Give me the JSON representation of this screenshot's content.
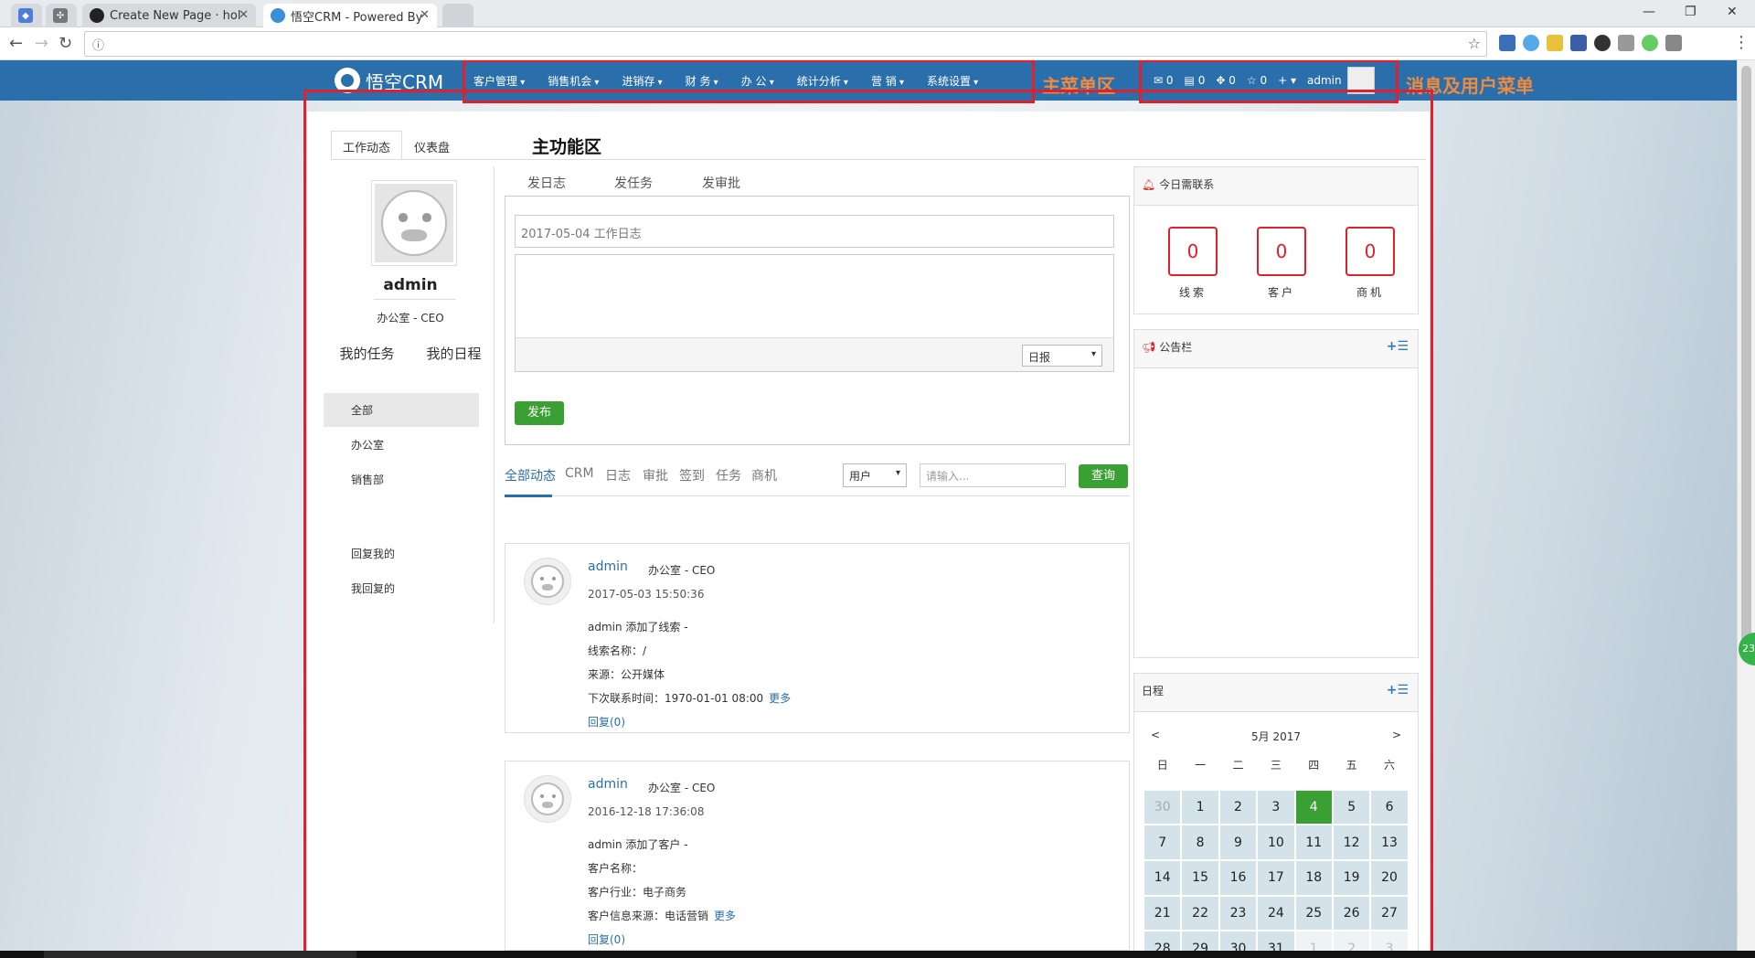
{
  "browser": {
    "tabs": [
      {
        "title": ""
      },
      {
        "title": ""
      },
      {
        "title": "Create New Page · hol"
      },
      {
        "title": "悟空CRM - Powered By"
      }
    ],
    "url": ""
  },
  "navbar": {
    "logo_text": "悟空CRM",
    "menu": [
      "客户管理",
      "销售机会",
      "进销存",
      "财 务",
      "办 公",
      "统计分析",
      "营 销",
      "系统设置"
    ],
    "menu_annotation": "主菜单区",
    "user": {
      "mail_count": "0",
      "msg_count": "0",
      "task_count": "0",
      "star_count": "0",
      "plus": "+",
      "username": "admin"
    },
    "user_annotation": "消息及用户菜单"
  },
  "main": {
    "area_annotation": "主功能区",
    "tabs": [
      "工作动态",
      "仪表盘"
    ],
    "profile": {
      "name": "admin",
      "role": "办公室 - CEO",
      "links": [
        "我的任务",
        "我的日程"
      ]
    },
    "side_groups": [
      "全部",
      "办公室",
      "销售部"
    ],
    "side_replies": [
      "回复我的",
      "我回复的"
    ],
    "post": {
      "tabs": [
        "发日志",
        "发任务",
        "发审批"
      ],
      "title_placeholder": "2017-05-04 工作日志",
      "type_select": "日报",
      "submit": "发布"
    },
    "filter": {
      "links": [
        "全部动态",
        "CRM",
        "日志",
        "审批",
        "签到",
        "任务",
        "商机"
      ],
      "user_select": "用户",
      "search_placeholder": "请输入...",
      "search_button": "查询"
    },
    "feed": [
      {
        "name": "admin",
        "role": "办公室 - CEO",
        "time": "2017-05-03 15:50:36",
        "lines": [
          "admin 添加了线索 -",
          "线索名称：/",
          "来源：公开媒体",
          "下次联系时间：1970-01-01 08:00"
        ],
        "more": "更多",
        "reply": "回复(0)"
      },
      {
        "name": "admin",
        "role": "办公室 - CEO",
        "time": "2016-12-18 17:36:08",
        "lines": [
          "admin 添加了客户 -",
          "客户名称：",
          "客户行业：电子商务",
          "客户信息来源：电话营销"
        ],
        "more": "更多",
        "reply": "回复(0)"
      }
    ],
    "contact_today": {
      "title": "今日需联系",
      "items": [
        {
          "count": "0",
          "label": "线索"
        },
        {
          "count": "0",
          "label": "客户"
        },
        {
          "count": "0",
          "label": "商机"
        }
      ]
    },
    "notice": {
      "title": "公告栏"
    },
    "schedule": {
      "title": "日程",
      "prev": "<",
      "next": ">",
      "month": "5月 2017",
      "weekdays": [
        "日",
        "一",
        "二",
        "三",
        "四",
        "五",
        "六"
      ],
      "days": [
        "30",
        "1",
        "2",
        "3",
        "4",
        "5",
        "6",
        "7",
        "8",
        "9",
        "10",
        "11",
        "12",
        "13",
        "14",
        "15",
        "16",
        "17",
        "18",
        "19",
        "20",
        "21",
        "22",
        "23",
        "24",
        "25",
        "26",
        "27",
        "28",
        "29",
        "30",
        "31",
        "1",
        "2",
        "3"
      ],
      "today": "4"
    }
  },
  "float_badge": "23",
  "colors": {
    "brand": "#2a6fac",
    "annotation_box": "#e0202a",
    "annotation_text": "#f08a3c",
    "primary_button": "#3aa033"
  }
}
